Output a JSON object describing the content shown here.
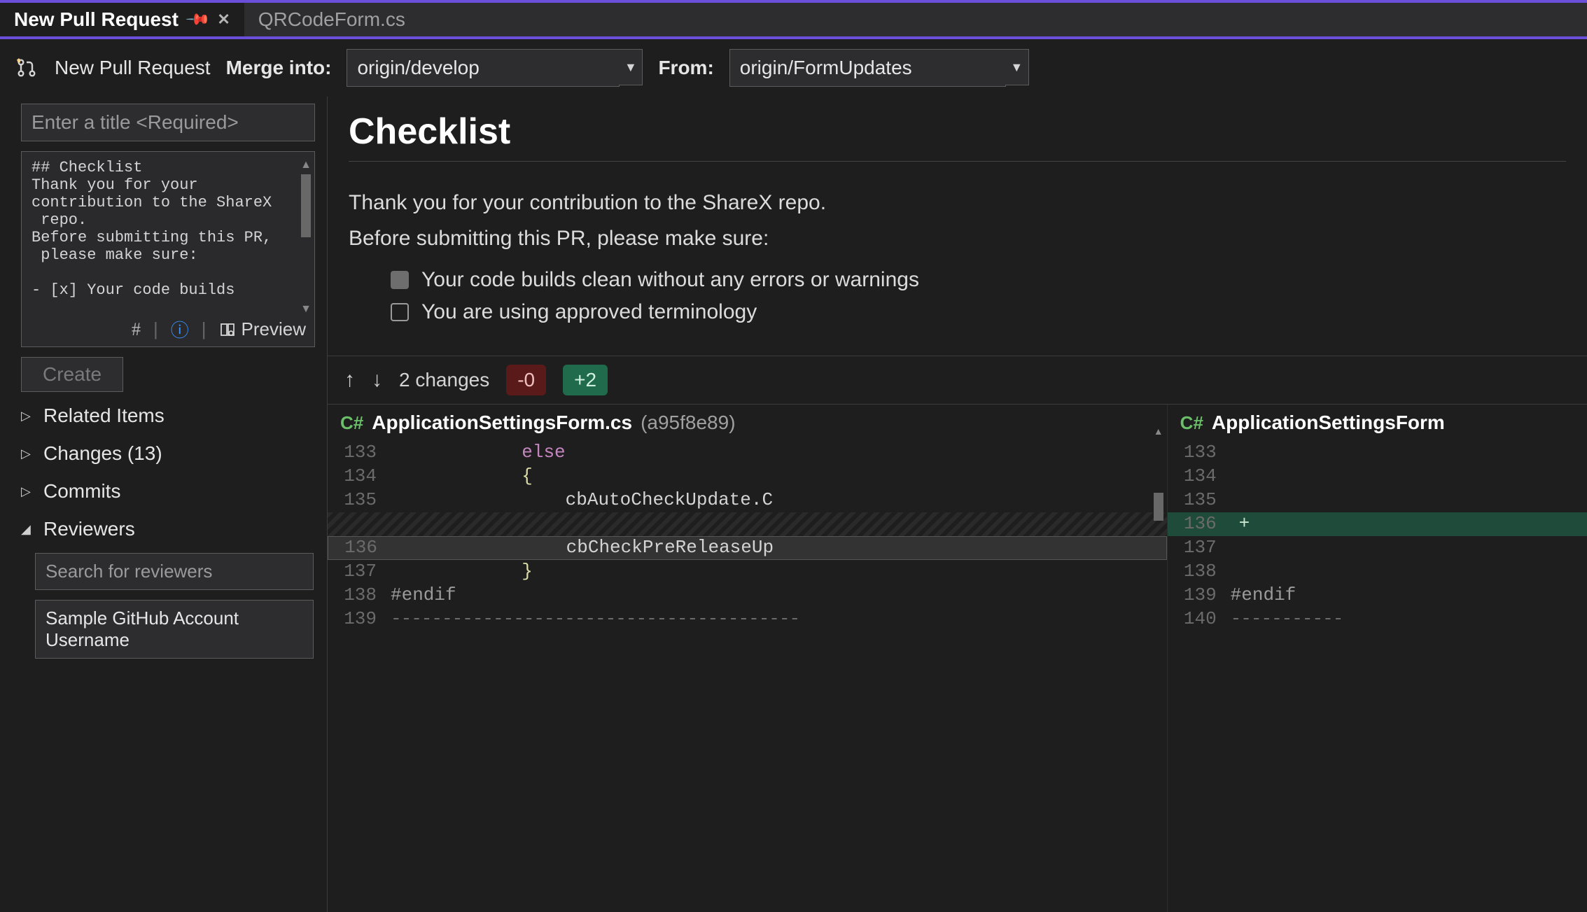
{
  "tabs": [
    {
      "label": "New Pull Request"
    },
    {
      "label": "QRCodeForm.cs"
    }
  ],
  "toolbar": {
    "title": "New Pull Request",
    "merge_into_label": "Merge into:",
    "merge_into_value": "origin/develop",
    "from_label": "From:",
    "from_value": "origin/FormUpdates"
  },
  "form": {
    "title_placeholder": "Enter a title <Required>",
    "description_raw": "## Checklist\nThank you for your\ncontribution to the ShareX\n repo.\nBefore submitting this PR,\n please make sure:\n\n- [x] Your code builds",
    "hash_icon": "#",
    "preview_label": "Preview",
    "create_label": "Create"
  },
  "tree": {
    "related_items": "Related Items",
    "changes": "Changes (13)",
    "commits": "Commits",
    "reviewers": "Reviewers",
    "reviewer_search_placeholder": "Search for reviewers",
    "reviewer_sample": "Sample GitHub Account Username"
  },
  "preview": {
    "heading": "Checklist",
    "line1": "Thank you for your contribution to the ShareX repo.",
    "line2": "Before submitting this PR, please make sure:",
    "check1": "Your code builds clean without any errors or warnings",
    "check2": "You are using approved terminology"
  },
  "diff": {
    "changes_text": "2 changes",
    "removed": "-0",
    "added": "+2",
    "left_file": "ApplicationSettingsForm.cs",
    "left_sha": "(a95f8e89)",
    "right_file": "ApplicationSettingsForm",
    "left_code": [
      {
        "num": "133",
        "text": "            else",
        "cls": "else"
      },
      {
        "num": "134",
        "text": "            {",
        "cls": "brace"
      },
      {
        "num": "135",
        "text": "                cbAutoCheckUpdate.C",
        "cls": ""
      },
      {
        "num": "",
        "text": "",
        "cls": "gap"
      },
      {
        "num": "136",
        "text": "                cbCheckPreReleaseUp",
        "cls": "highlight"
      },
      {
        "num": "137",
        "text": "            }",
        "cls": "brace"
      },
      {
        "num": "138",
        "text": "#endif",
        "cls": "endif"
      },
      {
        "num": "139",
        "text": "----------------------------------------",
        "cls": "dashed"
      }
    ],
    "right_code": [
      {
        "num": "133",
        "text": ""
      },
      {
        "num": "134",
        "text": ""
      },
      {
        "num": "135",
        "text": ""
      },
      {
        "num": "136",
        "text": "+",
        "cls": "added"
      },
      {
        "num": "137",
        "text": ""
      },
      {
        "num": "138",
        "text": ""
      },
      {
        "num": "139",
        "text": "#endif",
        "cls": "endif"
      },
      {
        "num": "140",
        "text": "-----------",
        "cls": "dashed"
      }
    ]
  }
}
